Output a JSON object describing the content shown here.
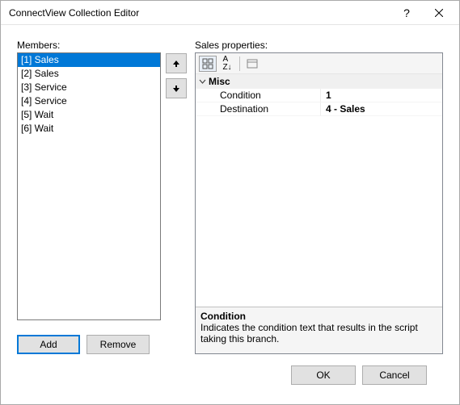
{
  "titlebar": {
    "title": "ConnectView Collection Editor"
  },
  "left": {
    "label": "Members:",
    "items": [
      "[1] Sales",
      "[2] Sales",
      "[3] Service",
      "[4] Service",
      "[5] Wait",
      "[6] Wait"
    ],
    "selected_index": 0,
    "add_label": "Add",
    "remove_label": "Remove"
  },
  "right": {
    "label": "Sales properties:",
    "category": "Misc",
    "rows": [
      {
        "name": "Condition",
        "value": "1"
      },
      {
        "name": "Destination",
        "value": "4 - Sales"
      }
    ],
    "desc_title": "Condition",
    "desc_text": "Indicates the condition text that results in the script taking this branch."
  },
  "footer": {
    "ok": "OK",
    "cancel": "Cancel"
  }
}
